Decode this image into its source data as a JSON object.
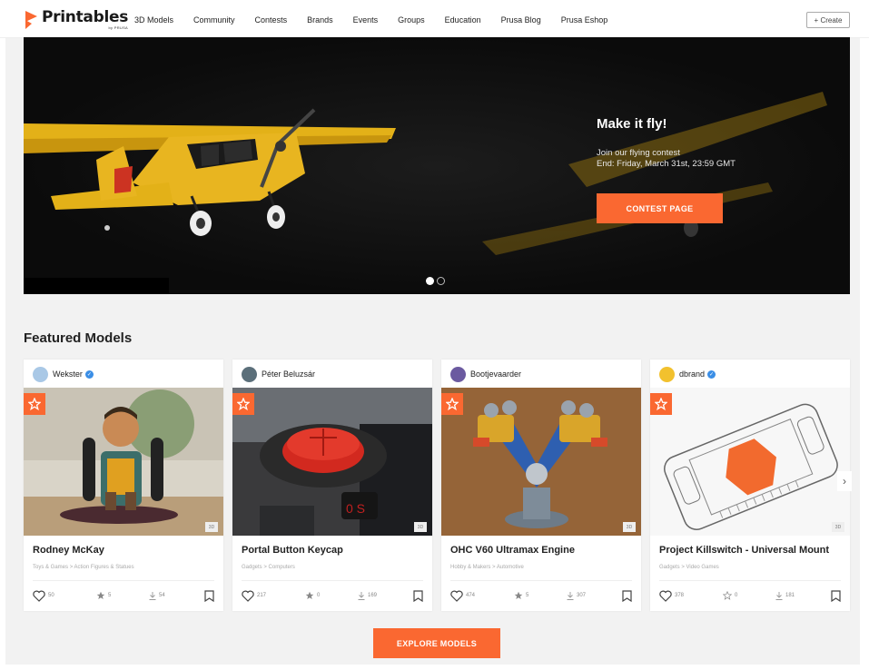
{
  "brand": {
    "name": "Printables",
    "sub": "by PRUSA"
  },
  "nav": [
    "3D Models",
    "Community",
    "Contests",
    "Brands",
    "Events",
    "Groups",
    "Education",
    "Prusa Blog",
    "Prusa Eshop"
  ],
  "create_label": "+ Create",
  "hero": {
    "title": "Make it fly!",
    "line1": "Join our flying contest",
    "line2": "End: Friday, March 31st, 23:59 GMT",
    "button": "CONTEST PAGE",
    "slides_total": 2,
    "slide_active": 1
  },
  "featured_title": "Featured Models",
  "cards": [
    {
      "user": "Wekster",
      "verified": true,
      "title": "Rodney McKay",
      "cat1": "Toys & Games",
      "cat2": "Action Figures & Statues",
      "likes": "50",
      "makes": "5",
      "downloads": "54",
      "badge": "3D"
    },
    {
      "user": "Péter Beluzsár",
      "verified": false,
      "title": "Portal Button Keycap",
      "cat1": "Gadgets",
      "cat2": "Computers",
      "likes": "217",
      "makes": "0",
      "downloads": "169",
      "badge": "3D"
    },
    {
      "user": "Bootjevaarder",
      "verified": false,
      "title": "OHC V60 Ultramax Engine",
      "cat1": "Hobby & Makers",
      "cat2": "Automotive",
      "likes": "474",
      "makes": "5",
      "downloads": "307",
      "badge": "3D"
    },
    {
      "user": "dbrand",
      "verified": true,
      "title": "Project Killswitch - Universal Mount",
      "cat1": "Gadgets",
      "cat2": "Video Games",
      "likes": "378",
      "makes": "0",
      "downloads": "181",
      "badge": "3D"
    }
  ],
  "explore_label": "EXPLORE MODELS",
  "colors": {
    "accent": "#fa6831",
    "verified": "#3a8ee6"
  }
}
